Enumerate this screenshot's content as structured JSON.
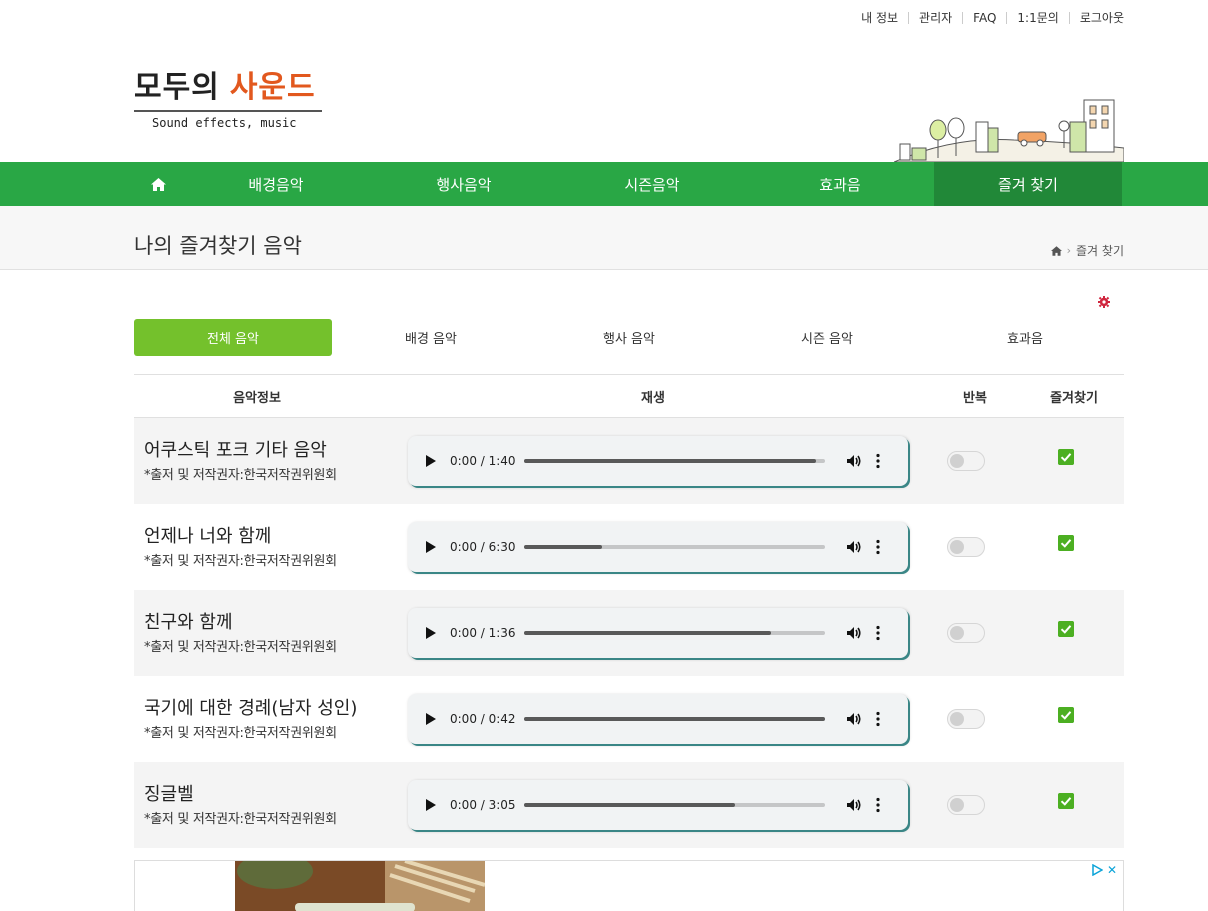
{
  "top_links": [
    "내 정보",
    "관리자",
    "FAQ",
    "1:1문의",
    "로그아웃"
  ],
  "logo": {
    "line1_a": "모두의",
    "line1_b": "사운드",
    "sub": "Sound effects, music"
  },
  "nav": {
    "home_icon": "home-icon",
    "items": [
      "배경음악",
      "행사음악",
      "시즌음악",
      "효과음",
      "즐겨 찾기"
    ],
    "active": "즐겨 찾기",
    "color": "#29a745",
    "active_color": "#218838"
  },
  "page": {
    "title": "나의 즐겨찾기 음악",
    "breadcrumb": "즐겨 찾기"
  },
  "tabs": {
    "items": [
      "전체 음악",
      "배경 음악",
      "행사 음악",
      "시즌 음악",
      "효과음"
    ],
    "active": "전체 음악",
    "active_color": "#74c12c"
  },
  "table": {
    "headers": [
      "음악정보",
      "재생",
      "반복",
      "즐겨찾기"
    ],
    "rows": [
      {
        "title": "어쿠스틱 포크 기타 음악",
        "credit": "*출저 및 저작권자:한국저작권위원회",
        "time": "0:00 / 1:40",
        "progress": 0.97,
        "repeat": false,
        "favorite": true
      },
      {
        "title": "언제나 너와 함께",
        "credit": "*출저 및 저작권자:한국저작권위원회",
        "time": "0:00 / 6:30",
        "progress": 0.26,
        "repeat": false,
        "favorite": true
      },
      {
        "title": "친구와 함께",
        "credit": "*출저 및 저작권자:한국저작권위원회",
        "time": "0:00 / 1:36",
        "progress": 0.82,
        "repeat": false,
        "favorite": true
      },
      {
        "title": "국기에 대한 경례(남자 성인)",
        "credit": "*출저 및 저작권자:한국저작권위원회",
        "time": "0:00 / 0:42",
        "progress": 1.0,
        "repeat": false,
        "favorite": true
      },
      {
        "title": "징글벨",
        "credit": "*출저 및 저작권자:한국저작권위원회",
        "time": "0:00 / 3:05",
        "progress": 0.7,
        "repeat": false,
        "favorite": true
      }
    ]
  },
  "icons": {
    "settings": "gear-icon",
    "play": "play-icon",
    "volume": "volume-icon",
    "more": "more-vert-icon",
    "favorite": "checkbox-checked-icon",
    "ad": "adchoices-icon",
    "ad_close": "close-icon"
  },
  "colors": {
    "brand_green": "#29a745",
    "logo_accent": "#e2581e",
    "fav_green": "#4caf22"
  }
}
